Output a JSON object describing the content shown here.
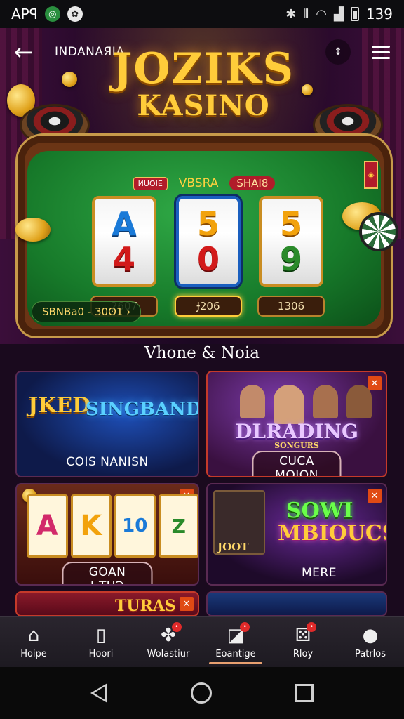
{
  "status_bar": {
    "carrier": "APꟼ",
    "time": "139",
    "signal_text": "⁴⁄₈"
  },
  "header": {
    "back_icon": "arrow-left-icon",
    "small_title": "INDANAЯIA",
    "logo_line1": "JOZIKS",
    "logo_line2": "KASINO"
  },
  "table": {
    "small_tag": "ИUOIE",
    "felt_title": "VBSRA",
    "felt_badge": "SHAI8",
    "reels": [
      {
        "sym1": "A",
        "sym2": "4",
        "value": "2607"
      },
      {
        "sym1": "5",
        "sym2": "0",
        "value": "Ɉ206"
      },
      {
        "sym1": "5",
        "sym2": "9",
        "value": "1306"
      }
    ],
    "jackpot": "SBNBa0 - 30ʘ1 ›",
    "side_flag": "◈"
  },
  "section_title": "Vhone & Noia",
  "cards": [
    {
      "art1": "JKED",
      "art2": "SINGBAND",
      "label": "COIS NANISN"
    },
    {
      "art1": "DLRADING",
      "art2": "SONGURS",
      "label": "CUCA MOION"
    },
    {
      "art1": "A K 10",
      "label": "GOAN ЬTUЭ"
    },
    {
      "art1": "SOWI",
      "art2": "MBIOUCS",
      "art3": "JOOT",
      "label": "MERE"
    },
    {
      "art1": "TURAS"
    },
    {
      "art1": ""
    }
  ],
  "bottom_nav": [
    {
      "icon": "home-icon",
      "label": "Hoipe"
    },
    {
      "icon": "card-icon",
      "label": "Hoori"
    },
    {
      "icon": "chips-icon",
      "label": "Wolastiur"
    },
    {
      "icon": "game-icon",
      "label": "Eoantige"
    },
    {
      "icon": "dice-icon",
      "label": "Rloy"
    },
    {
      "icon": "profile-icon",
      "label": "Patrlos"
    }
  ],
  "colors": {
    "accent": "#ffcc3a",
    "felt": "#177a2a",
    "close": "#e04a14"
  }
}
